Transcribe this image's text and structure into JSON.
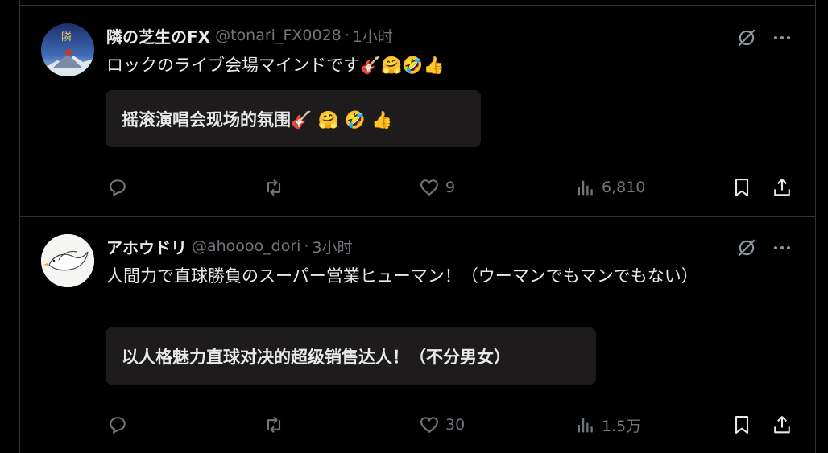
{
  "tweets": [
    {
      "display_name": "隣の芝生のFX",
      "handle": "@tonari_FX0028",
      "separator": "·",
      "time": "1小时",
      "avatar_text": "隣",
      "text": "ロックのライブ会場マインドです🎸🤗🤣👍",
      "translation": "摇滚演唱会现场的氛围🎸 🤗 🤣 👍",
      "reply_count": "",
      "retweet_count": "",
      "like_count": "9",
      "view_count": "6,810"
    },
    {
      "display_name": "アホウドリ",
      "handle": "@ahoooo_dori",
      "separator": "·",
      "time": "3小时",
      "text": "人間力で直球勝負のスーパー営業ヒューマン！（ウーマンでもマンでもない）",
      "translation": "以人格魅力直球对决的超级销售达人！（不分男女）",
      "reply_count": "",
      "retweet_count": "",
      "like_count": "30",
      "view_count": "1.5万"
    }
  ],
  "icons": {
    "translate_off": "translate-off-icon",
    "more": "more-icon",
    "reply": "reply-icon",
    "retweet": "retweet-icon",
    "like": "like-icon",
    "views": "views-icon",
    "bookmark": "bookmark-icon",
    "share": "share-icon"
  },
  "colors": {
    "background": "#000000",
    "text": "#e7e9ea",
    "muted": "#71767b",
    "border": "#2f3336",
    "translation_box": "#1e1b1c"
  }
}
